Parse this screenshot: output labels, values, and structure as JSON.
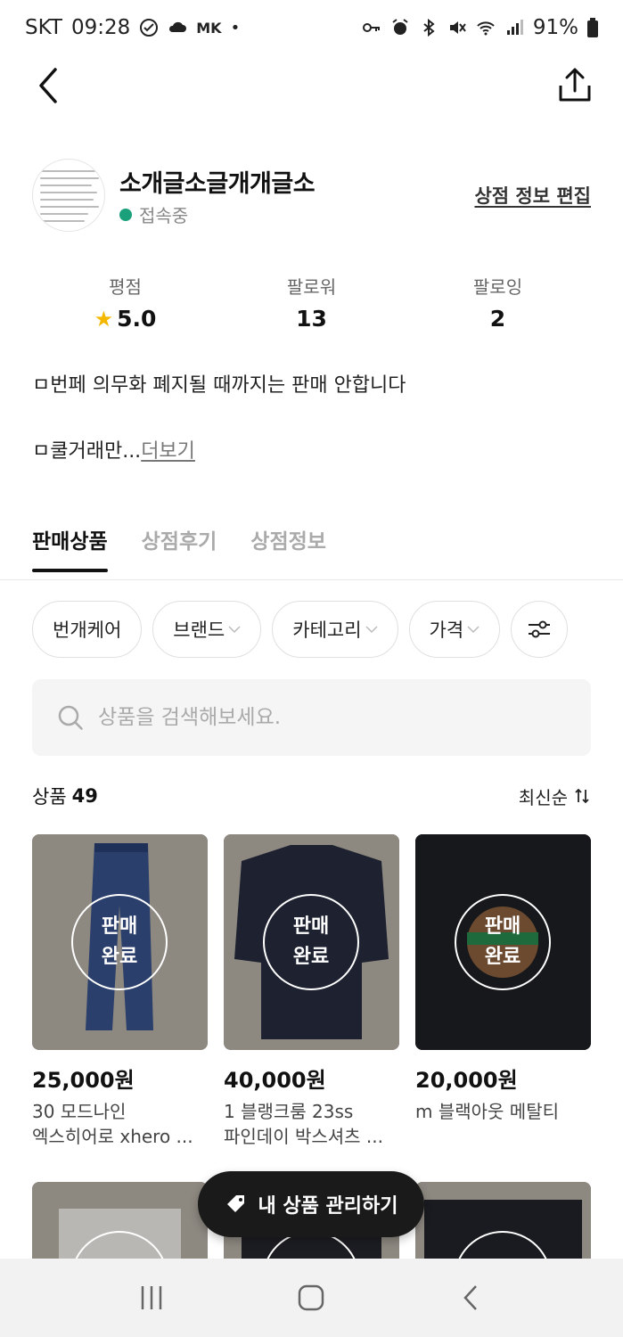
{
  "status_bar": {
    "carrier": "SKT",
    "time": "09:28",
    "extra": "MK",
    "battery": "91%"
  },
  "profile": {
    "shop_name": "소개글소글개개글소",
    "status": "접속중",
    "edit_label": "상점 정보 편집"
  },
  "stats": [
    {
      "label": "평점",
      "value": "5.0"
    },
    {
      "label": "팔로워",
      "value": "13"
    },
    {
      "label": "팔로잉",
      "value": "2"
    }
  ],
  "intro": {
    "line1": "ㅁ번페 의무화 폐지될 때까지는 판매 안합니다",
    "line2": "ㅁ쿨거래만...",
    "more": "더보기"
  },
  "tabs": [
    "판매상품",
    "상점후기",
    "상점정보"
  ],
  "filters": [
    "번개케어",
    "브랜드",
    "카테고리",
    "가격"
  ],
  "search": {
    "placeholder": "상품을 검색해보세요."
  },
  "list_header": {
    "label": "상품",
    "count": "49",
    "sort": "최신순"
  },
  "sold_badge": [
    "판매",
    "완료"
  ],
  "products": [
    {
      "price": "25,000원",
      "title_line1": "30 모드나인",
      "title_line2": "엑스히어로 xhero ..."
    },
    {
      "price": "40,000원",
      "title_line1": "1 블랭크룸 23ss",
      "title_line2": "파인데이 박스셔츠 ..."
    },
    {
      "price": "20,000원",
      "title_line1": "m 블랙아웃 메탈티",
      "title_line2": ""
    }
  ],
  "manage_button": "내 상품 관리하기"
}
